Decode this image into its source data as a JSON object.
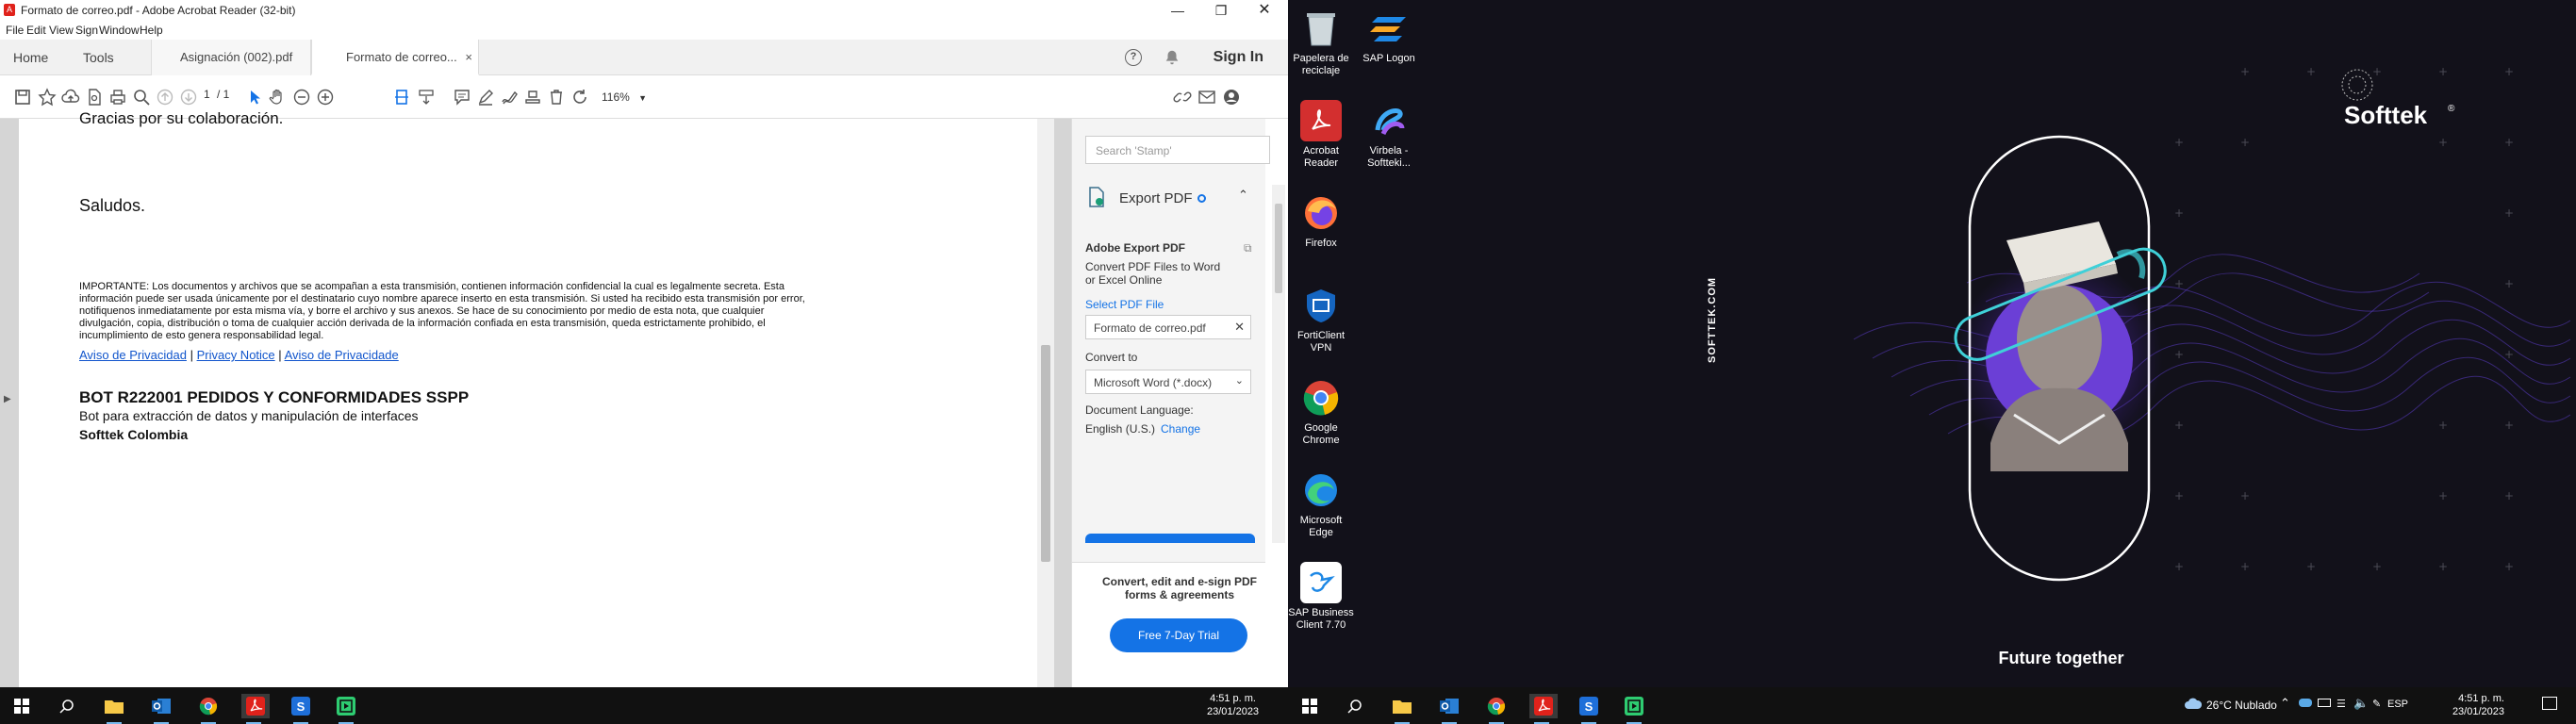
{
  "acrobat": {
    "window_title": "Formato de correo.pdf - Adobe Acrobat Reader (32-bit)",
    "menu": [
      "File",
      "Edit",
      "View",
      "Sign",
      "Window",
      "Help"
    ],
    "tabs": {
      "home": "Home",
      "tools": "Tools",
      "doc1": "Asignación (002).pdf",
      "doc2": "Formato de correo...",
      "close": "×"
    },
    "sign_in": "Sign In",
    "page_current": "1",
    "page_total": "/ 1",
    "zoom": "116%",
    "document": {
      "top_cut": "Gracias por su colaboración.",
      "saludos": "Saludos.",
      "legal": "IMPORTANTE: Los documentos y archivos que se acompañan a esta transmisión, contienen información confidencial la cual es legalmente secreta. Esta información puede ser usada únicamente por el destinatario cuyo nombre aparece inserto en esta transmisión. Si usted ha recibido esta transmisión por error, notifiquenos inmediatamente por esta misma vía, y borre el archivo y sus anexos. Se hace de su conocimiento por medio de esta nota, que cualquier divulgación, copia, distribución o toma de cualquier acción derivada de la información confiada en esta transmisión, queda estrictamente prohibido, el incumplimiento de esto genera responsabilidad legal.",
      "link1": "Aviso de Privacidad",
      "link2": "Privacy Notice",
      "link3": "Aviso de Privacidade",
      "sep": "|",
      "bot_title": "BOT R222001 PEDIDOS Y CONFORMIDADES SSPP",
      "bot_desc": "Bot para extracción de datos y manipulación de interfaces",
      "company": "Softtek Colombia"
    },
    "side_panel": {
      "search_placeholder": "Search 'Stamp'",
      "export_header": "Export PDF",
      "adobe_export": "Adobe Export PDF",
      "convert_desc_1": "Convert PDF Files to Word",
      "convert_desc_2": "or Excel Online",
      "select_file": "Select PDF File",
      "file_name": "Formato de correo.pdf",
      "convert_to": "Convert to",
      "format": "Microsoft Word (*.docx)",
      "doc_language": "Document Language:",
      "language": "English (U.S.)",
      "change": "Change",
      "promo_1": "Convert, edit and e-sign PDF",
      "promo_2": "forms & agreements",
      "trial": "Free 7-Day Trial"
    }
  },
  "taskbar_left": {
    "time": "4:51 p. m.",
    "date": "23/01/2023"
  },
  "desktop": {
    "icons": [
      {
        "label": "Papelera de reciclaje",
        "icon": "recycle-bin-icon"
      },
      {
        "label": "SAP Logon",
        "icon": "sap-logon-icon"
      },
      {
        "label": "Acrobat Reader",
        "icon": "acrobat-icon"
      },
      {
        "label": "Virbela - Softteki...",
        "icon": "virbela-icon"
      },
      {
        "label": "Firefox",
        "icon": "firefox-icon"
      },
      {
        "label": "FortiClient VPN",
        "icon": "forticlient-icon"
      },
      {
        "label": "Google Chrome",
        "icon": "chrome-icon"
      },
      {
        "label": "Microsoft Edge",
        "icon": "edge-icon"
      },
      {
        "label": "SAP Business Client 7.70",
        "icon": "sap-business-client-icon"
      }
    ],
    "brand": "Softtek",
    "brand_mark": "®",
    "side_text": "SOFTTEK.COM",
    "tagline": "Future together"
  },
  "taskbar_right": {
    "weather": "26°C  Nublado",
    "lang": "ESP",
    "time": "4:51 p. m.",
    "date": "23/01/2023"
  },
  "colors": {
    "acrobat_red": "#e0221b",
    "link_blue": "#1155cc",
    "adobe_blue": "#1473e6",
    "desktop_bg": "#12111a",
    "purple": "#6b3fd6"
  }
}
